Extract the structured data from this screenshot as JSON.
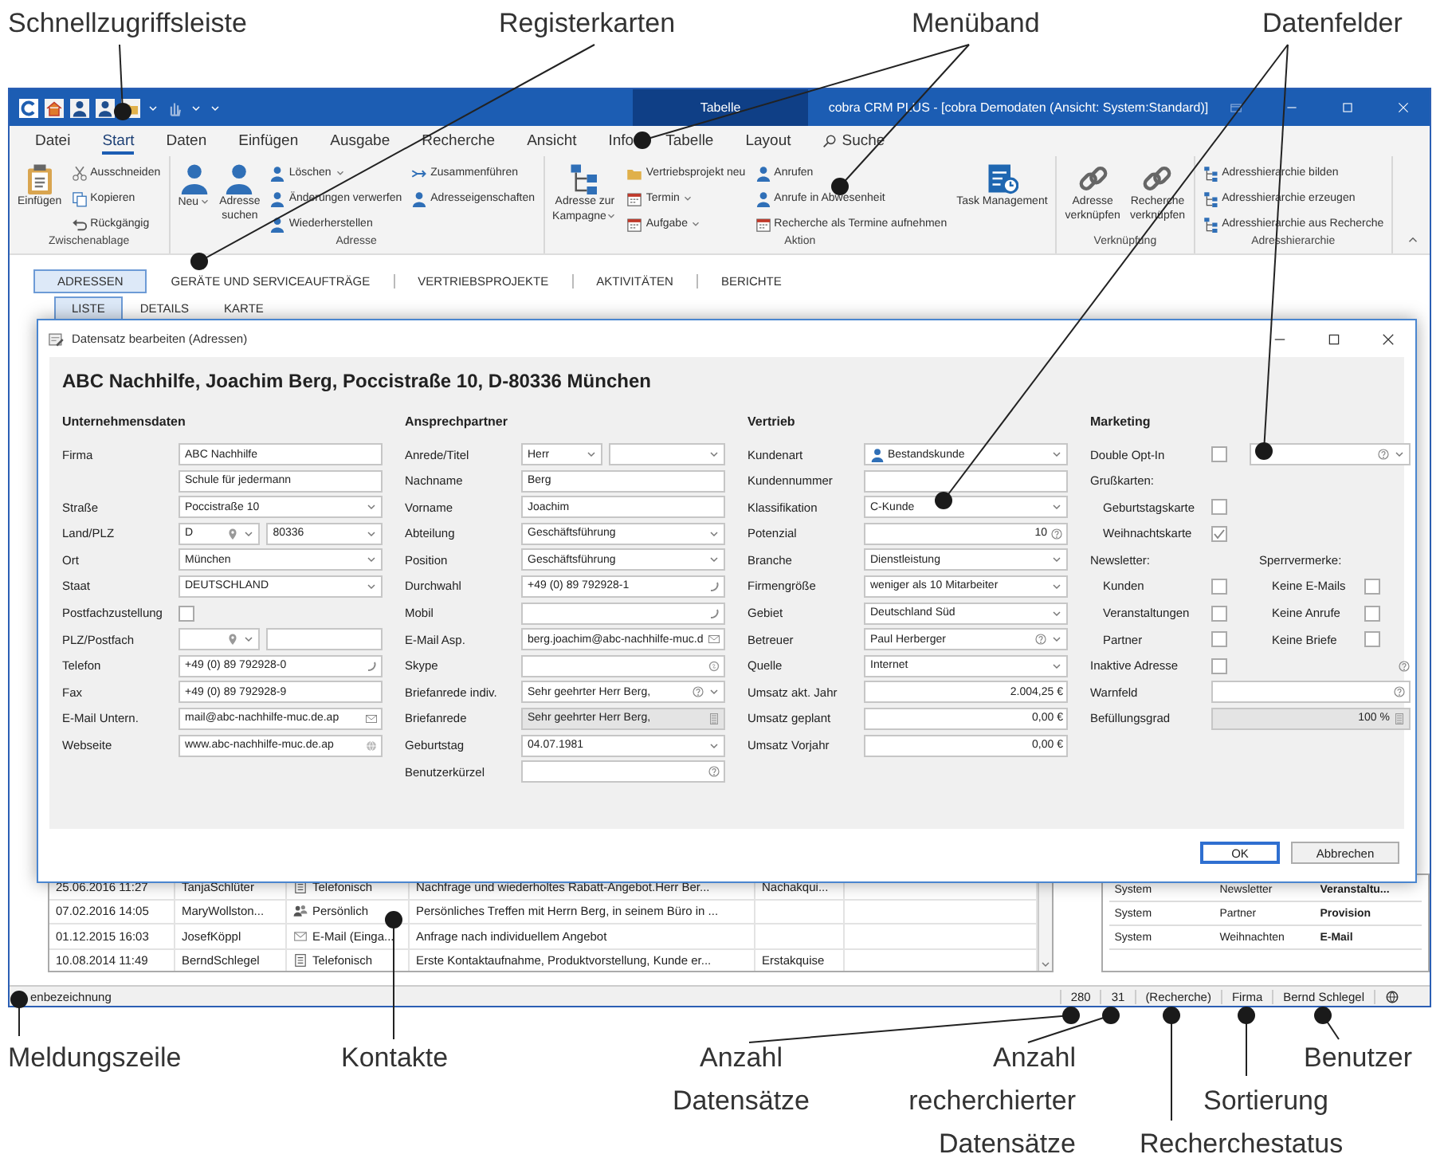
{
  "callouts": {
    "top": [
      "Schnellzugriffsleiste",
      "Registerkarten",
      "Menüband",
      "Datenfelder"
    ],
    "bottom": [
      "Meldungszeile",
      "Kontakte",
      "Anzahl Datensätze",
      "Anzahl recherchierter Datensätze",
      "Sortierung",
      "Recherchestatus",
      "Benutzer"
    ]
  },
  "window": {
    "title": "cobra CRM PLUS - [cobra Demodaten (Ansicht: System:Standard)]",
    "context_tab": "Tabelle"
  },
  "menu_tabs": [
    {
      "label": "Datei",
      "selected": false
    },
    {
      "label": "Start",
      "selected": true
    },
    {
      "label": "Daten",
      "selected": false
    },
    {
      "label": "Einfügen",
      "selected": false
    },
    {
      "label": "Ausgabe",
      "selected": false
    },
    {
      "label": "Recherche",
      "selected": false
    },
    {
      "label": "Ansicht",
      "selected": false
    },
    {
      "label": "Info",
      "selected": false
    },
    {
      "label": "Tabelle",
      "selected": false
    },
    {
      "label": "Layout",
      "selected": false
    },
    {
      "label": "Suche",
      "selected": false,
      "kind": "search"
    }
  ],
  "ribbon": {
    "groups": [
      {
        "label": "Zwischenablage",
        "items": [
          {
            "kind": "large",
            "label": "Einfügen"
          },
          {
            "kind": "stack",
            "buttons": [
              {
                "label": "Ausschneiden"
              },
              {
                "label": "Kopieren"
              },
              {
                "label": "Rückgängig"
              }
            ]
          }
        ]
      },
      {
        "label": "Adresse",
        "items": [
          {
            "kind": "large",
            "label": "Neu",
            "dropdown": true
          },
          {
            "kind": "large",
            "label": "Adresse\nsuchen"
          },
          {
            "kind": "stack",
            "buttons": [
              {
                "label": "Löschen",
                "dropdown": true
              },
              {
                "label": "Änderungen verwerfen"
              },
              {
                "label": "Wiederherstellen"
              }
            ]
          },
          {
            "kind": "stack",
            "buttons": [
              {
                "label": "Zusammenführen"
              },
              {
                "label": "Adresseigenschaften"
              }
            ]
          }
        ]
      },
      {
        "label": "Aktion",
        "items": [
          {
            "kind": "large",
            "label": "Adresse zur\nKampagne",
            "dropdown": true
          },
          {
            "kind": "stack",
            "buttons": [
              {
                "label": "Vertriebsprojekt neu"
              },
              {
                "label": "Termin",
                "dropdown": true
              },
              {
                "label": "Aufgabe",
                "dropdown": true
              }
            ]
          },
          {
            "kind": "stack",
            "buttons": [
              {
                "label": "Anrufen"
              },
              {
                "label": "Anrufe in Abwesenheit"
              },
              {
                "label": "Recherche als Termine aufnehmen"
              }
            ]
          },
          {
            "kind": "large",
            "label": "Task Management"
          }
        ]
      },
      {
        "label": "Verknüpfung",
        "items": [
          {
            "kind": "large",
            "label": "Adresse\nverknüpfen"
          },
          {
            "kind": "large",
            "label": "Recherche\nverknüpfen"
          }
        ]
      },
      {
        "label": "Adresshierarchie",
        "items": [
          {
            "kind": "stack",
            "buttons": [
              {
                "label": "Adresshierarchie bilden"
              },
              {
                "label": "Adresshierarchie erzeugen"
              },
              {
                "label": "Adresshierarchie aus Recherche"
              }
            ]
          }
        ]
      }
    ]
  },
  "nav_tabs": [
    {
      "label": "ADRESSEN",
      "selected": true
    },
    {
      "label": "GERÄTE UND SERVICEAUFTRÄGE",
      "selected": false
    },
    {
      "label": "VERTRIEBSPROJEKTE",
      "selected": false
    },
    {
      "label": "AKTIVITÄTEN",
      "selected": false
    },
    {
      "label": "BERICHTE",
      "selected": false
    }
  ],
  "sub_tabs": [
    {
      "label": "LISTE",
      "selected": true
    },
    {
      "label": "DETAILS",
      "selected": false
    },
    {
      "label": "KARTE",
      "selected": false
    }
  ],
  "dialog": {
    "title": "Datensatz bearbeiten (Adressen)",
    "heading": "ABC Nachhilfe, Joachim Berg, Poccistraße 10, D-80336 München",
    "columns": [
      {
        "title": "Unternehmensdaten",
        "rows": [
          {
            "kind": "field",
            "label": "Firma",
            "fields": [
              {
                "value": "ABC Nachhilfe"
              }
            ]
          },
          {
            "kind": "field",
            "fields": [
              {
                "value": "Schule für jedermann"
              }
            ]
          },
          {
            "kind": "field",
            "label": "Straße",
            "fields": [
              {
                "value": "Poccistraße 10",
                "dropdown": true
              }
            ]
          },
          {
            "kind": "field",
            "label": "Land/PLZ",
            "fields": [
              {
                "value": "D",
                "kind": "location",
                "dropdown": true
              },
              {
                "value": "80336",
                "dropdown": true
              }
            ]
          },
          {
            "kind": "field",
            "label": "Ort",
            "fields": [
              {
                "value": "München",
                "dropdown": true
              }
            ]
          },
          {
            "kind": "field",
            "label": "Staat",
            "fields": [
              {
                "value": "DEUTSCHLAND",
                "dropdown": true
              }
            ]
          },
          {
            "kind": "check",
            "label": "Postfachzustellung",
            "checked": false
          },
          {
            "kind": "field",
            "label": "PLZ/Postfach",
            "fields": [
              {
                "kind": "location",
                "dropdown": true
              },
              {
                "kind": "text"
              }
            ]
          },
          {
            "kind": "field",
            "label": "Telefon",
            "fields": [
              {
                "value": "+49 (0) 89 792928-0",
                "kind": "phone"
              }
            ]
          },
          {
            "kind": "field",
            "label": "Fax",
            "fields": [
              {
                "value": "+49 (0) 89 792928-9"
              }
            ]
          },
          {
            "kind": "field",
            "label": "E-Mail Untern.",
            "fields": [
              {
                "value": "mail@abc-nachhilfe-muc.de.ap",
                "kind": "mail"
              }
            ]
          },
          {
            "kind": "field",
            "label": "Webseite",
            "fields": [
              {
                "value": "www.abc-nachhilfe-muc.de.ap",
                "kind": "web"
              }
            ]
          }
        ]
      },
      {
        "title": "Ansprechpartner",
        "rows": [
          {
            "kind": "field",
            "label": "Anrede/Titel",
            "fields": [
              {
                "value": "Herr",
                "dropdown": true
              },
              {
                "dropdown": true
              }
            ]
          },
          {
            "kind": "field",
            "label": "Nachname",
            "fields": [
              {
                "value": "Berg"
              }
            ]
          },
          {
            "kind": "field",
            "label": "Vorname",
            "fields": [
              {
                "value": "Joachim"
              }
            ]
          },
          {
            "kind": "field",
            "label": "Abteilung",
            "fields": [
              {
                "value": "Geschäftsführung",
                "dropdown": true
              }
            ]
          },
          {
            "kind": "field",
            "label": "Position",
            "fields": [
              {
                "value": "Geschäftsführung",
                "dropdown": true
              }
            ]
          },
          {
            "kind": "field",
            "label": "Durchwahl",
            "fields": [
              {
                "value": "+49 (0) 89 792928-1",
                "kind": "phone"
              }
            ]
          },
          {
            "kind": "field",
            "label": "Mobil",
            "fields": [
              {
                "kind": "phone"
              }
            ]
          },
          {
            "kind": "field",
            "label": "E-Mail Asp.",
            "fields": [
              {
                "value": "berg.joachim@abc-nachhilfe-muc.d",
                "kind": "mail"
              }
            ]
          },
          {
            "kind": "field",
            "label": "Skype",
            "fields": [
              {
                "kind": "chat"
              }
            ]
          },
          {
            "kind": "field",
            "label": "Briefanrede indiv.",
            "fields": [
              {
                "value": "Sehr geehrter Herr Berg,",
                "kind": "help",
                "dropdown": true
              }
            ]
          },
          {
            "kind": "field",
            "label": "Briefanrede",
            "fields": [
              {
                "value": "Sehr geehrter Herr Berg,",
                "kind": "calc",
                "readonly": true
              }
            ]
          },
          {
            "kind": "field",
            "label": "Geburtstag",
            "fields": [
              {
                "value": "04.07.1981",
                "dropdown": true
              }
            ]
          },
          {
            "kind": "field",
            "label": "Benutzerkürzel",
            "fields": [
              {
                "kind": "help"
              }
            ]
          }
        ]
      },
      {
        "title": "Vertrieb",
        "rows": [
          {
            "kind": "field",
            "label": "Kundenart",
            "fields": [
              {
                "value": "Bestandskunde",
                "kind": "person",
                "dropdown": true
              }
            ]
          },
          {
            "kind": "field",
            "label": "Kundennummer",
            "fields": [
              {
                "kind": "text"
              }
            ]
          },
          {
            "kind": "field",
            "label": "Klassifikation",
            "fields": [
              {
                "value": "C-Kunde",
                "dropdown": true
              }
            ]
          },
          {
            "kind": "field",
            "label": "Potenzial",
            "fields": [
              {
                "value": "10",
                "kind": "help",
                "numeric": true
              }
            ]
          },
          {
            "kind": "field",
            "label": "Branche",
            "fields": [
              {
                "value": "Dienstleistung",
                "dropdown": true
              }
            ]
          },
          {
            "kind": "field",
            "label": "Firmengröße",
            "fields": [
              {
                "value": "weniger als 10 Mitarbeiter",
                "dropdown": true
              }
            ]
          },
          {
            "kind": "field",
            "label": "Gebiet",
            "fields": [
              {
                "value": "Deutschland Süd",
                "dropdown": true
              }
            ]
          },
          {
            "kind": "field",
            "label": "Betreuer",
            "fields": [
              {
                "value": "Paul Herberger",
                "kind": "help",
                "dropdown": true
              }
            ]
          },
          {
            "kind": "field",
            "label": "Quelle",
            "fields": [
              {
                "value": "Internet",
                "dropdown": true
              }
            ]
          },
          {
            "kind": "field",
            "label": "Umsatz akt. Jahr",
            "fields": [
              {
                "value": "2.004,25 €",
                "numeric": true
              }
            ]
          },
          {
            "kind": "field",
            "label": "Umsatz geplant",
            "fields": [
              {
                "value": "0,00 €",
                "numeric": true
              }
            ]
          },
          {
            "kind": "field",
            "label": "Umsatz Vorjahr",
            "fields": [
              {
                "value": "0,00 €",
                "numeric": true
              }
            ]
          }
        ]
      },
      {
        "title": "Marketing",
        "rows": [
          {
            "kind": "check",
            "label": "Double Opt-In",
            "checked": false,
            "fields": [
              {
                "kind": "help",
                "dropdown": true
              }
            ]
          },
          {
            "kind": "heading",
            "texts": [
              "Grußkarten:"
            ]
          },
          {
            "kind": "check",
            "label": "Geburtstagskarte",
            "checked": false,
            "indent": true
          },
          {
            "kind": "check",
            "label": "Weihnachtskarte",
            "checked": true,
            "indent": true
          },
          {
            "kind": "heading",
            "texts": [
              "Newsletter:",
              "Sperrvermerke:"
            ]
          },
          {
            "kind": "check_pair",
            "items": [
              {
                "label": "Kunden",
                "checked": false
              },
              {
                "label": "Keine E-Mails",
                "checked": false
              }
            ]
          },
          {
            "kind": "check_pair",
            "items": [
              {
                "label": "Veranstaltungen",
                "checked": false
              },
              {
                "label": "Keine Anrufe",
                "checked": false
              }
            ]
          },
          {
            "kind": "check_pair",
            "items": [
              {
                "label": "Partner",
                "checked": false
              },
              {
                "label": "Keine Briefe",
                "checked": false
              }
            ]
          },
          {
            "kind": "check",
            "label": "Inaktive Adresse",
            "checked": false,
            "help": true
          },
          {
            "kind": "field",
            "label": "Warnfeld",
            "fields": [
              {
                "kind": "help"
              }
            ]
          },
          {
            "kind": "field",
            "label": "Befüllungsgrad",
            "fields": [
              {
                "value": "100 %",
                "kind": "calc",
                "numeric": true,
                "readonly": true
              }
            ]
          }
        ]
      }
    ],
    "buttons": [
      {
        "label": "OK",
        "default": true
      },
      {
        "label": "Abbrechen",
        "default": false
      }
    ]
  },
  "contacts": {
    "rows": [
      {
        "kind": "phone",
        "cells": [
          "25.06.2016 11:27",
          "TanjaSchlüter",
          "Telefonisch",
          "Nachfrage und wiederholtes Rabatt-Angebot.Herr Ber...",
          "Nachakqui..."
        ]
      },
      {
        "kind": "meeting",
        "cells": [
          "07.02.2016 14:05",
          "MaryWollston...",
          "Persönlich",
          "Persönliches Treffen mit Herrn Berg, in seinem Büro in ..."
        ]
      },
      {
        "kind": "mail",
        "cells": [
          "01.12.2015 16:03",
          "JosefKöppl",
          "E-Mail (Einga...",
          "Anfrage nach individuellem Angebot"
        ]
      },
      {
        "kind": "phone",
        "cells": [
          "10.08.2014 11:49",
          "BerndSchlegel",
          "Telefonisch",
          "Erste Kontaktaufnahme, Produktvorstellung, Kunde er...",
          "Erstakquise"
        ]
      }
    ]
  },
  "properties": {
    "rows": [
      {
        "cells": [
          "System",
          "Newsletter",
          "Veranstaltu..."
        ]
      },
      {
        "cells": [
          "System",
          "Partner",
          "Provision"
        ]
      },
      {
        "cells": [
          "System",
          "Weihnachten",
          "E-Mail"
        ]
      }
    ]
  },
  "status_bar": {
    "message": "enbezeichnung",
    "cells": [
      "280",
      "31",
      "(Recherche)",
      "Firma",
      "Bernd Schlegel"
    ]
  }
}
